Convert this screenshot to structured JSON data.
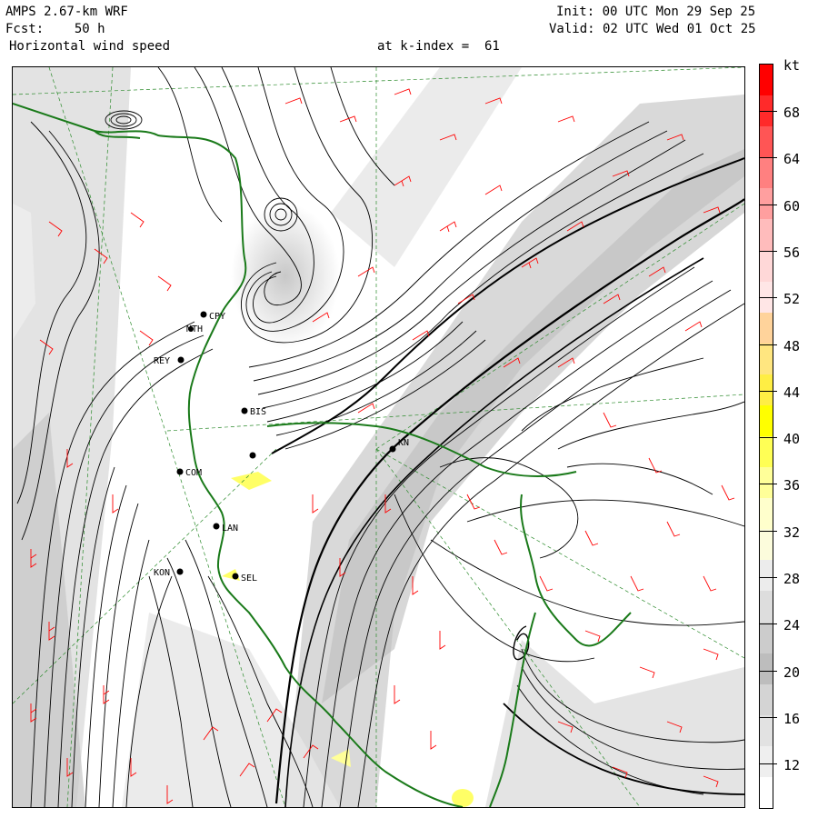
{
  "header": {
    "model": "AMPS 2.67-km WRF",
    "forecast": "Fcst:    50 h",
    "field": "Horizontal wind speed",
    "init": "Init: 00 UTC Mon 29 Sep 25",
    "valid": "Valid: 02 UTC Wed 01 Oct 25",
    "level": "at k-index =  61"
  },
  "colorbar": {
    "unit": "kt",
    "labels": [
      "68",
      "64",
      "60",
      "56",
      "52",
      "48",
      "44",
      "40",
      "36",
      "32",
      "28",
      "24",
      "20",
      "16",
      "12"
    ],
    "colors": [
      "#ff0000",
      "#ff2a2a",
      "#ff5555",
      "#ff8080",
      "#ff9f9f",
      "#ffbcbc",
      "#ffd8d8",
      "#ffe6e6",
      "#ffd39b",
      "#ffe680",
      "#ffee44",
      "#ffff00",
      "#ffff55",
      "#ffff99",
      "#ffffcc",
      "#fcfcdc",
      "#ececec",
      "#dddddd",
      "#cccccc",
      "#bdbdbd",
      "#d4d4d4",
      "#e2e2e2",
      "#efefef",
      "#ffffff"
    ]
  },
  "stations": [
    {
      "id": "CPY",
      "label": "CPY"
    },
    {
      "id": "MTH",
      "label": "MTH"
    },
    {
      "id": "REY",
      "label": "REY"
    },
    {
      "id": "BIS",
      "label": "BIS"
    },
    {
      "id": "STN5",
      "label": ""
    },
    {
      "id": "COM",
      "label": "COM"
    },
    {
      "id": "KN",
      "label": "KN"
    },
    {
      "id": "LAN",
      "label": "LAN"
    },
    {
      "id": "KON",
      "label": "KON"
    },
    {
      "id": "SEL",
      "label": "SEL"
    }
  ]
}
